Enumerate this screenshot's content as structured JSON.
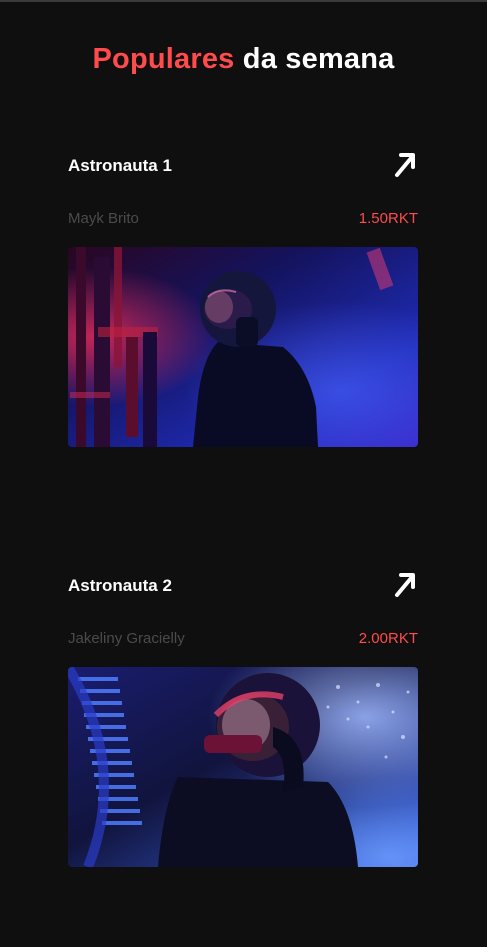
{
  "page": {
    "heading_accent": "Populares",
    "heading_rest": "da semana"
  },
  "colors": {
    "background": "#0f0f0f",
    "accent": "#ff4b4b",
    "text": "#ffffff",
    "muted": "#4b4b4b"
  },
  "cards": [
    {
      "title": "Astronauta 1",
      "author": "Mayk Brito",
      "price": "1.50RKT",
      "icon": "arrow-up-right-icon",
      "image": "astronaut-photo-red-blue"
    },
    {
      "title": "Astronauta 2",
      "author": "Jakeliny Gracielly",
      "price": "2.00RKT",
      "icon": "arrow-up-right-icon",
      "image": "astronaut-photo-blue"
    }
  ]
}
